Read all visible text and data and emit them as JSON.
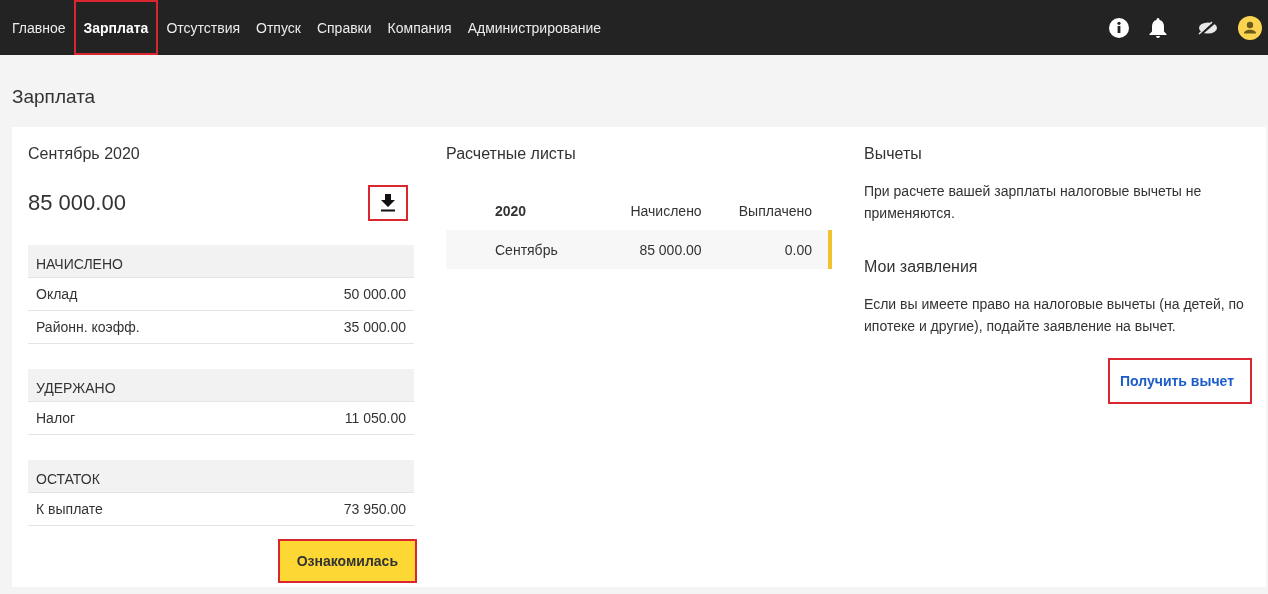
{
  "nav": {
    "items": [
      {
        "label": "Главное",
        "selected": false,
        "highlighted": false
      },
      {
        "label": "Зарплата",
        "selected": true,
        "highlighted": true
      },
      {
        "label": "Отсутствия",
        "selected": false,
        "highlighted": false
      },
      {
        "label": "Отпуск",
        "selected": false,
        "highlighted": false
      },
      {
        "label": "Справки",
        "selected": false,
        "highlighted": false
      },
      {
        "label": "Компания",
        "selected": false,
        "highlighted": false
      },
      {
        "label": "Администрирование",
        "selected": false,
        "highlighted": false
      }
    ]
  },
  "page_title": "Зарплата",
  "summary": {
    "period": "Сентябрь 2020",
    "amount": "85 000.00",
    "download_highlighted": true,
    "groups": [
      {
        "title": "НАЧИСЛЕНО",
        "rows": [
          {
            "label": "Оклад",
            "value": "50 000.00"
          },
          {
            "label": "Районн. коэфф.",
            "value": "35 000.00"
          }
        ]
      },
      {
        "title": "УДЕРЖАНО",
        "rows": [
          {
            "label": "Налог",
            "value": "11 050.00"
          }
        ]
      },
      {
        "title": "ОСТАТОК",
        "rows": [
          {
            "label": "К выплате",
            "value": "73 950.00"
          }
        ]
      }
    ],
    "button": {
      "label": "Ознакомилась",
      "highlighted": true
    }
  },
  "payslips": {
    "title": "Расчетные листы",
    "columns": [
      "2020",
      "Начислено",
      "Выплачено"
    ],
    "rows": [
      {
        "cells": [
          "Сентябрь",
          "85 000.00",
          "0.00"
        ],
        "selected": true
      }
    ]
  },
  "deductions": {
    "title": "Вычеты",
    "text": "При расчете вашей зарплаты налоговые вычеты не применяются.",
    "applications_title": "Мои заявления",
    "applications_text": "Если вы имеете право на налоговые вычеты (на детей, по ипотеке и другие), подайте заявление на вычет.",
    "button": {
      "label": "Получить вычет",
      "highlighted": true
    }
  }
}
